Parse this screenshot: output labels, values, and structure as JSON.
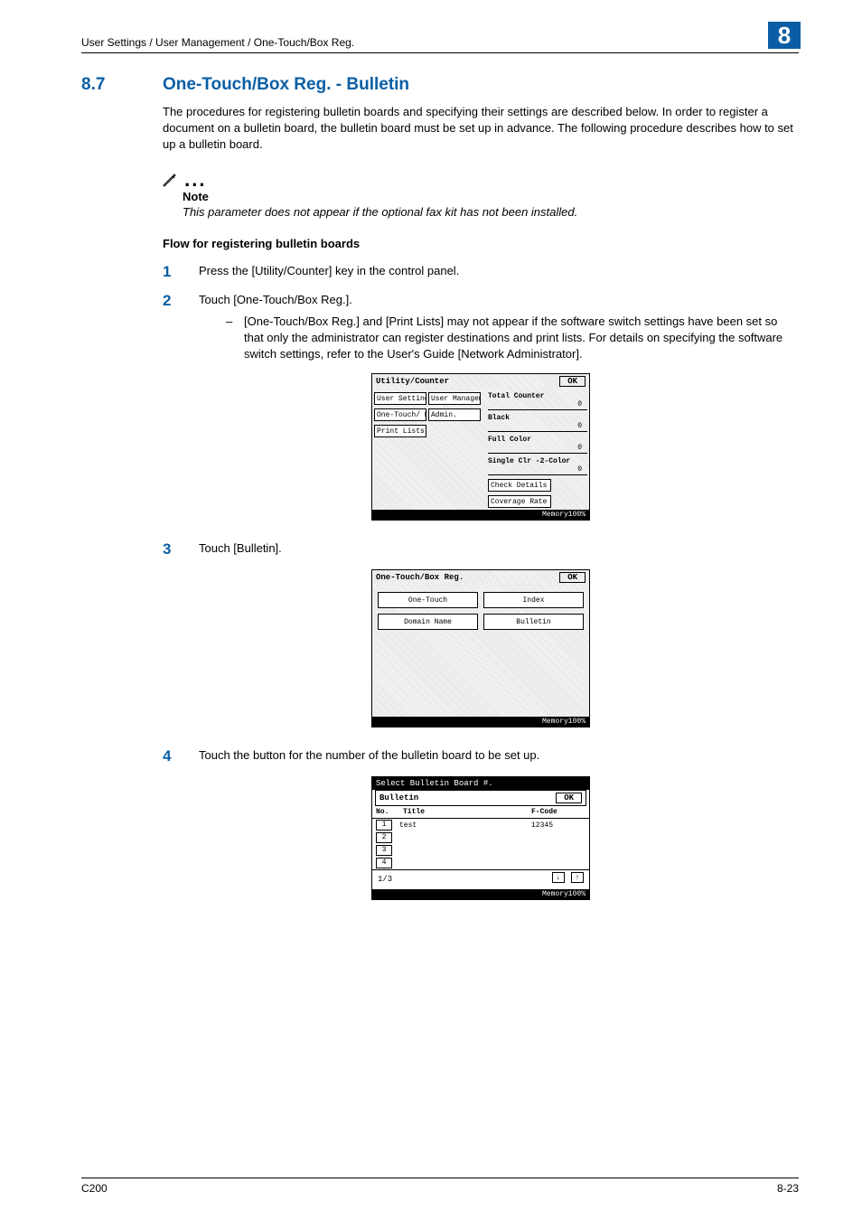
{
  "header": {
    "breadcrumb": "User Settings / User Management / One-Touch/Box Reg.",
    "chapter": "8"
  },
  "section": {
    "number": "8.7",
    "title": "One-Touch/Box Reg. - Bulletin",
    "intro": "The procedures for registering bulletin boards and specifying their settings are described below. In order to register a document on a bulletin board, the bulletin board must be set up in advance. The following procedure describes how to set up a bulletin board."
  },
  "note": {
    "label": "Note",
    "text": "This parameter does not appear if the optional fax kit has not been installed."
  },
  "flow": {
    "title": "Flow for registering bulletin boards",
    "steps": [
      {
        "n": "1",
        "text": "Press the [Utility/Counter] key in the control panel."
      },
      {
        "n": "2",
        "text": "Touch [One-Touch/Box Reg.].",
        "sub": "[One-Touch/Box Reg.] and [Print Lists] may not appear if the software switch settings have been set so that only the administrator can register destinations and print lists. For details on specifying the software switch settings, refer to the User's Guide [Network Administrator]."
      },
      {
        "n": "3",
        "text": "Touch [Bulletin]."
      },
      {
        "n": "4",
        "text": "Touch the button for the number of the bulletin board to be set up."
      }
    ]
  },
  "screen1": {
    "title": "Utility/Counter",
    "ok": "OK",
    "buttons": [
      "User Settings",
      "User Management",
      "One-Touch/ Box Reg.",
      "Admin.",
      "Print Lists"
    ],
    "counters": {
      "total_label": "Total Counter",
      "total": "0",
      "black_label": "Black",
      "black": "0",
      "full_label": "Full Color",
      "full": "0",
      "single_label": "Single Clr -2-Color",
      "single": "0",
      "check": "Check Details",
      "coverage": "Coverage Rate"
    },
    "memory": "Memory100%"
  },
  "screen2": {
    "title": "One-Touch/Box Reg.",
    "ok": "OK",
    "buttons": [
      "One-Touch",
      "Index",
      "Domain Name",
      "Bulletin"
    ],
    "memory": "Memory100%"
  },
  "screen3": {
    "title": "Select Bulletin Board #.",
    "sub": "Bulletin",
    "ok": "OK",
    "cols": {
      "no": "No.",
      "title": "Title",
      "fcode": "F-Code"
    },
    "rows": [
      {
        "n": "1",
        "title": "test",
        "fcode": "12345"
      },
      {
        "n": "2",
        "title": "",
        "fcode": ""
      },
      {
        "n": "3",
        "title": "",
        "fcode": ""
      },
      {
        "n": "4",
        "title": "",
        "fcode": ""
      }
    ],
    "page": "1/3",
    "memory": "Memory100%"
  },
  "footer": {
    "left": "C200",
    "right": "8-23"
  }
}
